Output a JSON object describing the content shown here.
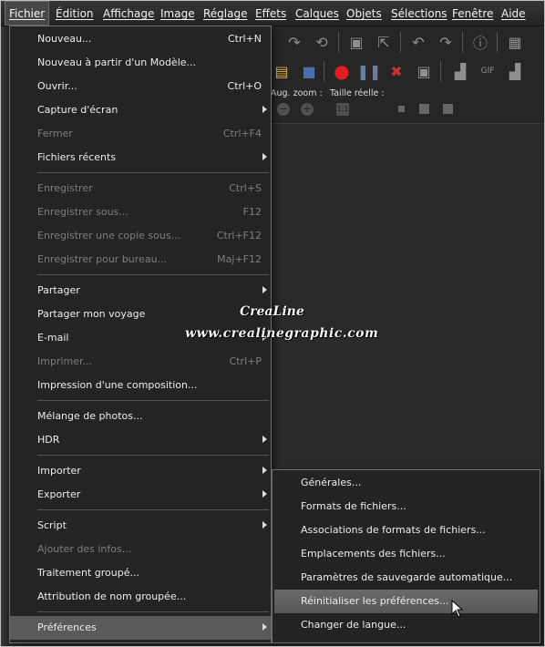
{
  "menubar": {
    "items": [
      "Fichier",
      "Édition",
      "Affichage",
      "Image",
      "Réglage",
      "Effets",
      "Calques",
      "Objets",
      "Sélections",
      "Fenêtre",
      "Aide"
    ]
  },
  "toolbar": {
    "zoom_label": "Aug. zoom :",
    "actual_size_label": "Taille réelle :"
  },
  "file_menu": {
    "new": {
      "label": "Nouveau...",
      "shortcut": "Ctrl+N"
    },
    "new_from_template": {
      "label": "Nouveau à partir d'un Modèle..."
    },
    "open": {
      "label": "Ouvrir...",
      "shortcut": "Ctrl+O"
    },
    "screen_capture": {
      "label": "Capture d'écran"
    },
    "close": {
      "label": "Fermer",
      "shortcut": "Ctrl+F4"
    },
    "recent_files": {
      "label": "Fichiers récents"
    },
    "save": {
      "label": "Enregistrer",
      "shortcut": "Ctrl+S"
    },
    "save_as": {
      "label": "Enregistrer sous...",
      "shortcut": "F12"
    },
    "save_copy_as": {
      "label": "Enregistrer une copie sous...",
      "shortcut": "Ctrl+F12"
    },
    "save_for_office": {
      "label": "Enregistrer pour bureau...",
      "shortcut": "Maj+F12"
    },
    "share": {
      "label": "Partager"
    },
    "share_trip": {
      "label": "Partager mon voyage"
    },
    "email": {
      "label": "E-mail"
    },
    "print": {
      "label": "Imprimer...",
      "shortcut": "Ctrl+P"
    },
    "print_layout": {
      "label": "Impression d'une composition..."
    },
    "photo_blend": {
      "label": "Mélange de photos..."
    },
    "hdr": {
      "label": "HDR"
    },
    "import": {
      "label": "Importer"
    },
    "export": {
      "label": "Exporter"
    },
    "script": {
      "label": "Script"
    },
    "add_info": {
      "label": "Ajouter des infos..."
    },
    "batch_process": {
      "label": "Traitement groupé..."
    },
    "batch_rename": {
      "label": "Attribution de nom groupée..."
    },
    "preferences": {
      "label": "Préférences"
    }
  },
  "preferences_submenu": {
    "items": [
      "Générales...",
      "Formats de fichiers...",
      "Associations de formats de fichiers...",
      "Emplacements des fichiers...",
      "Paramètres de sauvegarde automatique...",
      "Réinitialiser les préférences...",
      "Changer de langue..."
    ],
    "highlighted_index": 5
  },
  "watermark": {
    "brand": "CreaLine",
    "url": "www.crealinegraphic.com"
  },
  "colors": {
    "menu_bg": "#242424",
    "highlight": "#5a5a5a",
    "disabled_text": "#7e7e7e",
    "record_red": "#e02020",
    "stop_red": "#c83030"
  }
}
